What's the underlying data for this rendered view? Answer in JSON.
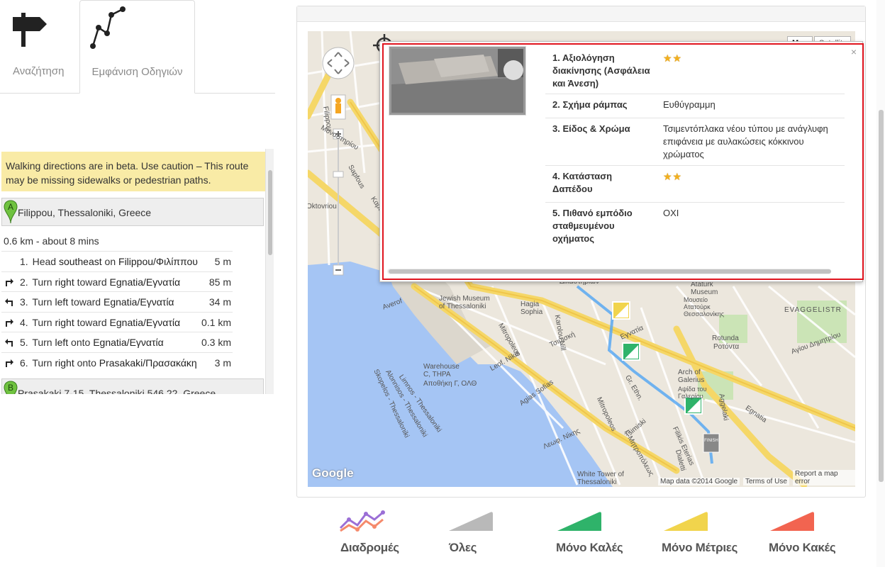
{
  "tabs": [
    {
      "label": "Αναζήτηση"
    },
    {
      "label": "Εμφάνιση Οδηγιών"
    }
  ],
  "directions": {
    "warning": "Walking directions are in beta. Use caution – This route may be missing sidewalks or pedestrian paths.",
    "start_marker": "A",
    "start": "Filippou, Thessaloniki, Greece",
    "summary": "0.6 km - about 8 mins",
    "steps": [
      {
        "num": "1.",
        "pre": "Head ",
        "b1": "southeast",
        "mid": " on ",
        "b2": "Filippou/Φιλίππου",
        "dist": "5 m"
      },
      {
        "num": "2.",
        "pre": "Turn ",
        "b1": "right",
        "mid": " toward ",
        "b2": "Egnatia/Εγνατία",
        "dist": "85 m"
      },
      {
        "num": "3.",
        "pre": "Turn ",
        "b1": "left",
        "mid": " toward ",
        "b2": "Egnatia/Εγνατία",
        "dist": "34 m"
      },
      {
        "num": "4.",
        "pre": "Turn ",
        "b1": "right",
        "mid": " toward ",
        "b2": "Egnatia/Εγνατία",
        "dist": "0.1 km"
      },
      {
        "num": "5.",
        "pre": "Turn ",
        "b1": "left",
        "mid": " onto ",
        "b2": "Egnatia/Εγνατία",
        "dist": "0.3 km"
      },
      {
        "num": "6.",
        "pre": "Turn ",
        "b1": "right",
        "mid": " onto ",
        "b2": "Prasakaki/Πρασακάκη",
        "dist": "3 m"
      }
    ],
    "end_marker": "B",
    "end": "Prasakaki 7-15, Thessaloniki 546 22, Greece"
  },
  "map": {
    "type_map": "Map",
    "type_satellite": "Satellite",
    "logo": "Google",
    "attribution": "Map data ©2014 Google",
    "terms": "Terms of Use",
    "report": "Report a map error",
    "finish_label": "FINISH",
    "labels": {
      "oktovriou": "Oktovriou",
      "sapfous": "Sapfous",
      "filippou": "Filippou",
      "sapfous2": "Sapfous",
      "karatasou": "Καρατάσου",
      "monastiriou": "Μοναστηρίου",
      "averof": "Averof",
      "jewish_museum": "Jewish Museum\nof Thessaloniki",
      "hagia_sophia": "Hagia\nSophia",
      "tsimiski": "Τσιμισκή",
      "leof_nikis": "Leof. Nikis",
      "mitropoleos": "Mitropoleos",
      "karolou_nill": "Karolou Nill",
      "warehouse": "Warehouse\nC, THPA",
      "warehouse_gr": "Αποθήκη Γ, ΟΛΘ",
      "limnos": "Limnos - Thessaloniki",
      "alonnisos": "Alonnisos - Thessaloniki",
      "skopelos": "Skopelos - Thessaloniki",
      "agias_sofias": "Agias Sofias",
      "leof_nikis_gr": "Λεωφ. Νίκης",
      "mitropoleos2": "Mitropoleos",
      "tsimiski2": "Tsimiski",
      "egnatia": "Εγνατία",
      "egnatia2": "Egnatia",
      "ataturk": "Ataturk\nMuseum",
      "ataturk_gr": "Μουσείο\nΑτατούρκ\nΘεσσαλονίκης",
      "rotunda": "Rotunda",
      "rotunda_gr": "Ροτόντα",
      "arch": "Arch of\nGalerius",
      "arch_gr": "Αψίδα του\nΓαλερίου",
      "aggelaki": "Aggelaki",
      "evaggelistr": "EVAGGELISTR",
      "agiou_dimitriou": "Αγίου Δημητρίου",
      "dikastirion": "Δικαστηρίων",
      "white_tower": "White Tower of\nThessaloniki",
      "gr_mitropoleos": "Γ. Μητροπόλεως",
      "filikis_eterias": "Filikis Eterias",
      "dialetti": "Dialetti",
      "gr_ethn": "Gr. Ethn."
    }
  },
  "info": {
    "close": "×",
    "rows": [
      {
        "k": "1. Αξιολόγηση διακίνησης (Ασφάλεια και Άνεση)",
        "v": "",
        "stars": 2
      },
      {
        "k": "2. Σχήμα ράμπας",
        "v": "Ευθύγραμμη",
        "stars": 0
      },
      {
        "k": "3. Είδος & Χρώμα",
        "v": "Τσιμεντόπλακα νέου τύπου με ανάγλυφη επιφάνεια με αυλακώσεις κόκκινου χρώματος",
        "stars": 0
      },
      {
        "k": "4. Κατάσταση Δαπέδου",
        "v": "",
        "stars": 2
      },
      {
        "k": "5. Πιθανό εμπόδιο σταθμευμένου οχήματος",
        "v": "ΟΧΙ",
        "stars": 0
      }
    ]
  },
  "legend": [
    {
      "label": "Διαδρομές",
      "color": "#9b6fd6"
    },
    {
      "label": "Όλες",
      "color": "#b9b9b9"
    },
    {
      "label": "Μόνο Καλές",
      "color": "#2fb36a"
    },
    {
      "label": "Μόνο Μέτριες",
      "color": "#f1d44c"
    },
    {
      "label": "Μόνο Κακές",
      "color": "#f26450"
    }
  ]
}
